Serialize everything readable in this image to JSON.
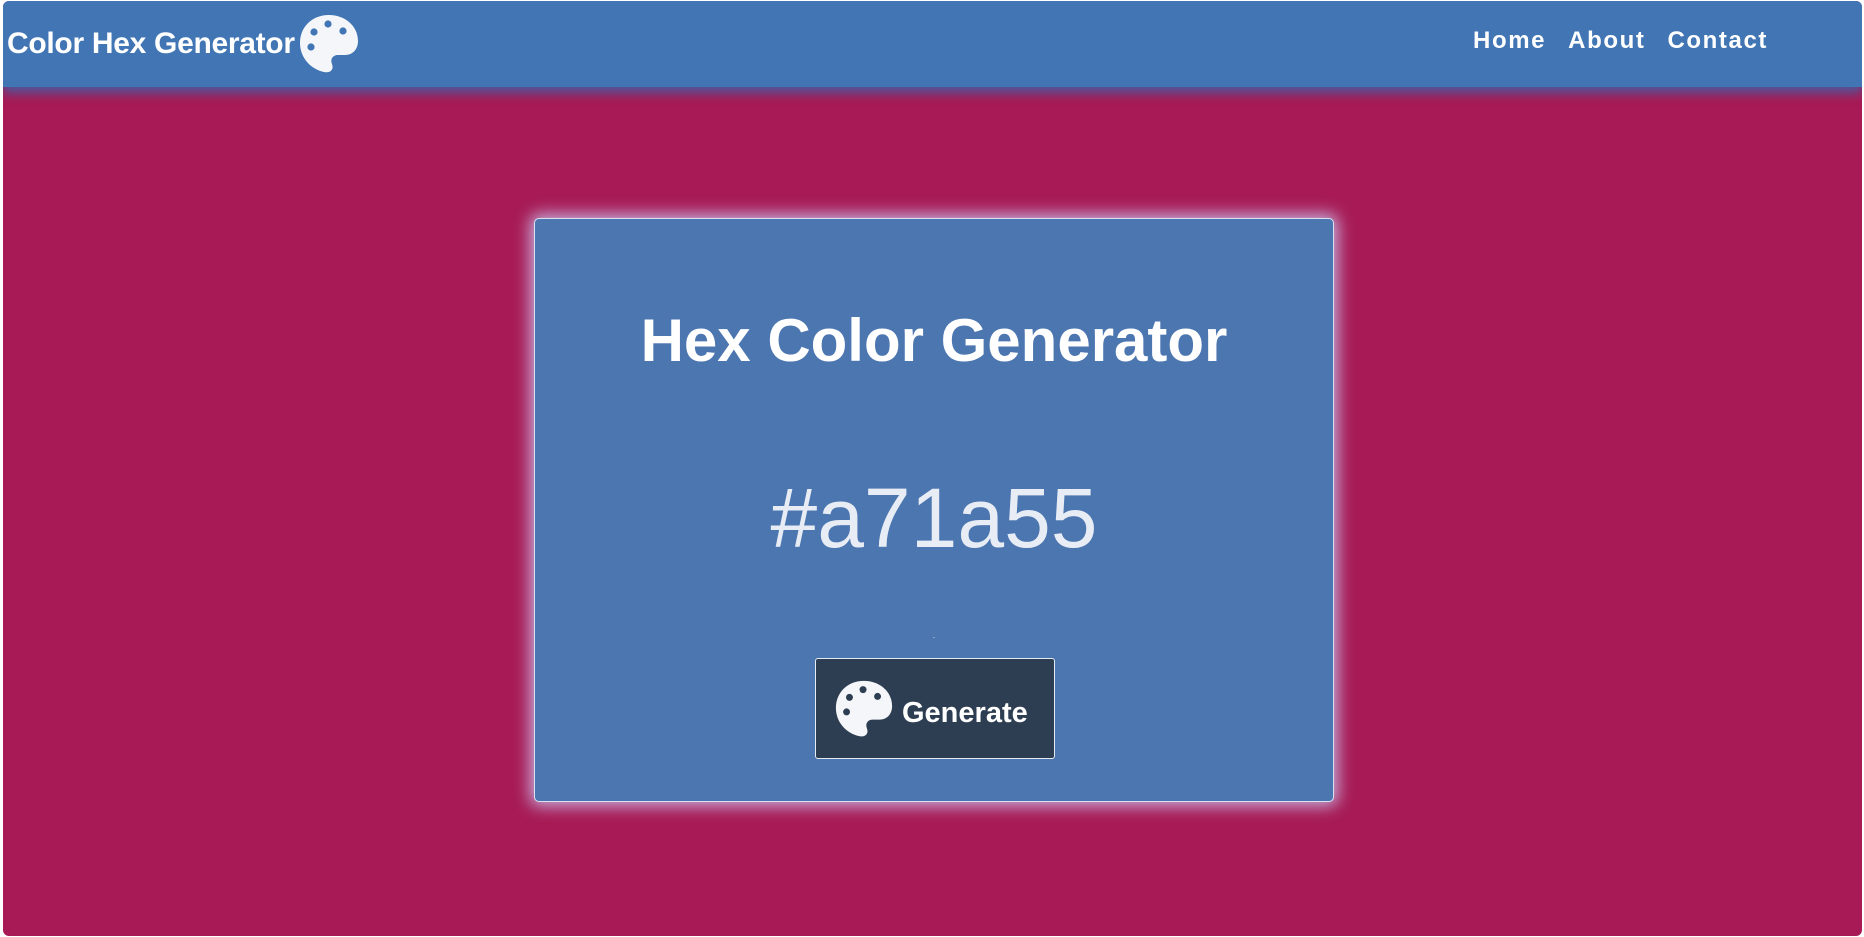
{
  "navbar": {
    "brand_title": "Color Hex Generator",
    "brand_icon": "palette-icon",
    "links": [
      "Home",
      "About",
      "Contact"
    ]
  },
  "card": {
    "title": "Hex Color Generator",
    "hex_value": "#a71a55",
    "button_label": "Generate",
    "button_icon": "palette-icon"
  },
  "colors": {
    "page_background": "#a71a55",
    "navbar_background": "#4175b4",
    "card_background": "#4b76b0",
    "button_background": "#2e3e52",
    "text": "#ffffff"
  }
}
